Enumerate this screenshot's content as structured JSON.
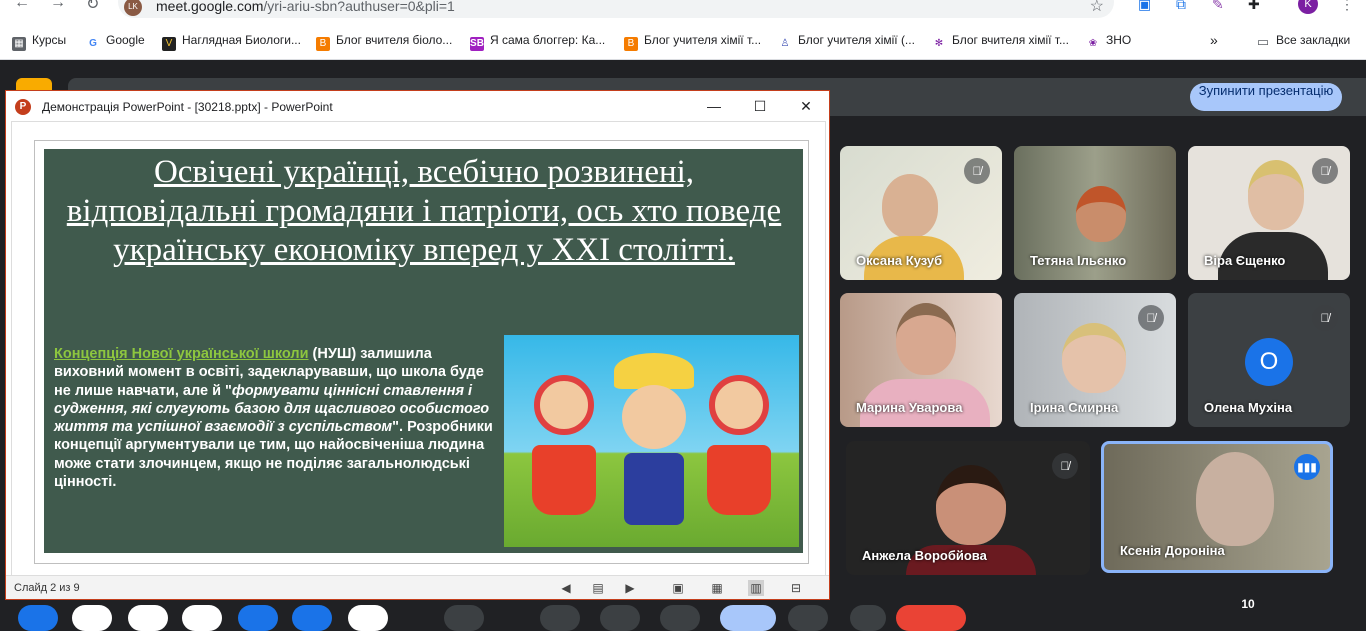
{
  "browser": {
    "url_host": "meet.google.com",
    "url_path": "/yri-ariu-sbn?authuser=0&pli=1",
    "profile_initial": "K",
    "bookmarks": [
      {
        "label": "Курсы",
        "icon": "apps-icon"
      },
      {
        "label": "Google",
        "icon": "google-icon"
      },
      {
        "label": "Наглядная Биологи...",
        "icon": "book-icon"
      },
      {
        "label": "Блог вчителя біоло...",
        "icon": "blogger-icon"
      },
      {
        "label": "Я сама блоггер: Ка...",
        "icon": "sb-icon"
      },
      {
        "label": "Блог учителя хімії т...",
        "icon": "blogger-icon"
      },
      {
        "label": "Блог учителя хімії (...",
        "icon": "person-icon"
      },
      {
        "label": "Блог вчителя хімії т...",
        "icon": "molecule-icon"
      },
      {
        "label": "ЗНО",
        "icon": "zno-icon"
      }
    ],
    "all_bookmarks": "Все закладки"
  },
  "meet": {
    "stop_presenting": "Зупинити презентацію",
    "people_count": "10",
    "participants": [
      {
        "name": "Оксана Кузуб",
        "muted": true
      },
      {
        "name": "Тетяна Ільєнко",
        "muted": false
      },
      {
        "name": "Віра Єщенко",
        "muted": true
      },
      {
        "name": "Марина Уварова",
        "muted": false
      },
      {
        "name": "Ірина Смирна",
        "muted": true
      },
      {
        "name": "Олена Мухіна",
        "muted": true,
        "initial": "О"
      },
      {
        "name": "Анжела Воробйова",
        "muted": true
      },
      {
        "name": "Ксенія Дороніна",
        "speaking": true
      }
    ]
  },
  "powerpoint": {
    "caption": "Демонстрація PowerPoint - [30218.pptx] - PowerPoint",
    "status": "Слайд 2 из 9",
    "slide": {
      "title": "Освічені українці, всебічно розвинені, відповідальні громадяни і патріоти, ось хто поведе українську економіку вперед у ХХІ столітті.",
      "link_text": "Концепція Нової української школи",
      "body_1": " (НУШ) залишила виховний момент в освіті, задекларувавши, що школа буде не лише навчати, але й \"",
      "body_italic": "формувати ціннісні ставлення і судження, які слугують базою для щасливого особистого життя та успішної взаємодії з суспільством",
      "body_2": "\". Розробники концепції аргументували це тим, що найосвіченіша людина може стати злочинцем, якщо не поділяє загальнолюдські цінності."
    }
  }
}
